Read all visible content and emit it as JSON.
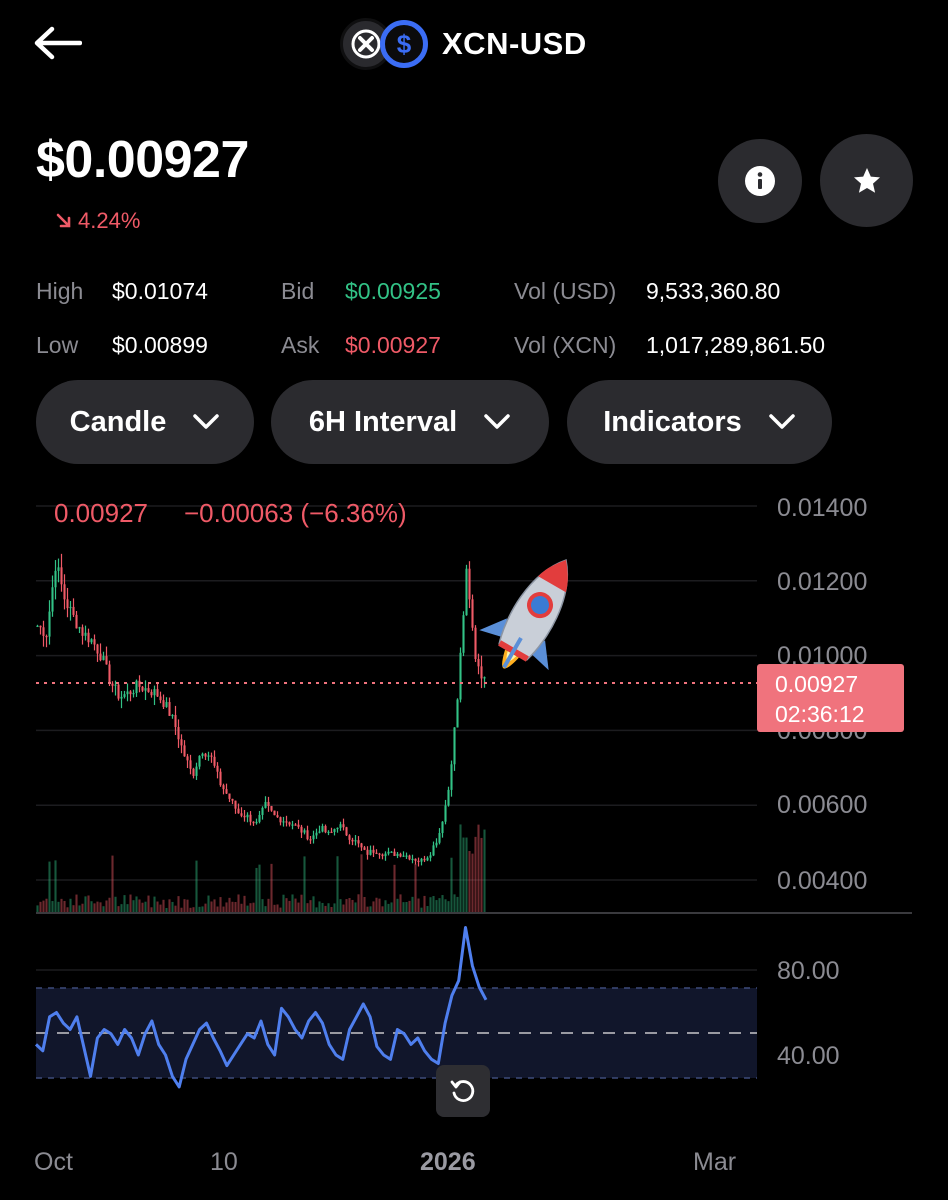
{
  "header": {
    "pair": "XCN-USD",
    "icons": {
      "back": "arrow-left-icon",
      "coin": "onyxcoin-logo-icon",
      "quote": "usd-coin-icon"
    }
  },
  "summary": {
    "price": "$0.00927",
    "change_pct": "4.24%",
    "change_direction": "down",
    "info_icon": "info-icon",
    "favorite_icon": "star-icon"
  },
  "stats": {
    "high_label": "High",
    "high_value": "$0.01074",
    "low_label": "Low",
    "low_value": "$0.00899",
    "bid_label": "Bid",
    "bid_value": "$0.00925",
    "ask_label": "Ask",
    "ask_value": "$0.00927",
    "vol_usd_label": "Vol (USD)",
    "vol_usd_value": "9,533,360.80",
    "vol_xcn_label": "Vol (XCN)",
    "vol_xcn_value": "1,017,289,861.50"
  },
  "controls": {
    "chart_type": "Candle",
    "interval": "6H Interval",
    "indicators": "Indicators"
  },
  "chart_header": {
    "last": "0.00927",
    "change": "−0.00063 (−6.36%)"
  },
  "price_tag": {
    "price": "0.00927",
    "countdown": "02:36:12"
  },
  "colors": {
    "up": "#32c286",
    "down": "#ef5a67",
    "rsi_line": "#4f7fee",
    "accent_blue": "#3b6df5",
    "price_tag_bg": "#f0737d"
  },
  "chart_data": [
    {
      "type": "line",
      "title": "",
      "xlabel": "",
      "ylabel": "",
      "y_ticks": [
        "0.01400",
        "0.01200",
        "0.01000",
        "0.00800",
        "0.00600",
        "0.00400"
      ],
      "x_ticks": [
        "Oct",
        "10",
        "2026",
        "Mar"
      ],
      "ylim": [
        0.0033,
        0.0141
      ],
      "grid": true,
      "last_price_line": 0.00927,
      "approx_close_path": {
        "x_labels_order": [
          "Oct",
          "10",
          "2026"
        ],
        "values": [
          0.0108,
          0.0106,
          0.0125,
          0.0115,
          0.011,
          0.0106,
          0.0104,
          0.01,
          0.0093,
          0.0089,
          0.009,
          0.0092,
          0.0091,
          0.009,
          0.0087,
          0.0082,
          0.0074,
          0.0068,
          0.0075,
          0.0073,
          0.0066,
          0.0062,
          0.0058,
          0.0057,
          0.0055,
          0.006,
          0.0057,
          0.0056,
          0.0055,
          0.0053,
          0.0051,
          0.0054,
          0.0052,
          0.0055,
          0.0052,
          0.005,
          0.0047,
          0.0048,
          0.0047,
          0.0047,
          0.0047,
          0.0046,
          0.0045,
          0.0047,
          0.0052,
          0.0063,
          0.0087,
          0.0122,
          0.01,
          0.0093
        ]
      }
    },
    {
      "type": "line",
      "title": "",
      "y_ticks": [
        "80.00",
        "40.00"
      ],
      "ylim": [
        15,
        110
      ],
      "band": [
        30,
        70
      ],
      "midline": 50,
      "values": [
        45,
        42,
        58,
        60,
        55,
        52,
        58,
        44,
        30,
        48,
        52,
        50,
        45,
        52,
        48,
        40,
        50,
        56,
        45,
        40,
        30,
        25,
        38,
        45,
        52,
        55,
        48,
        42,
        35,
        40,
        45,
        50,
        48,
        56,
        45,
        40,
        62,
        58,
        52,
        48,
        56,
        60,
        55,
        45,
        40,
        38,
        52,
        58,
        64,
        58,
        44,
        40,
        38,
        52,
        50,
        45,
        48,
        42,
        38,
        36,
        55,
        68,
        75,
        100,
        82,
        72,
        66
      ]
    }
  ]
}
